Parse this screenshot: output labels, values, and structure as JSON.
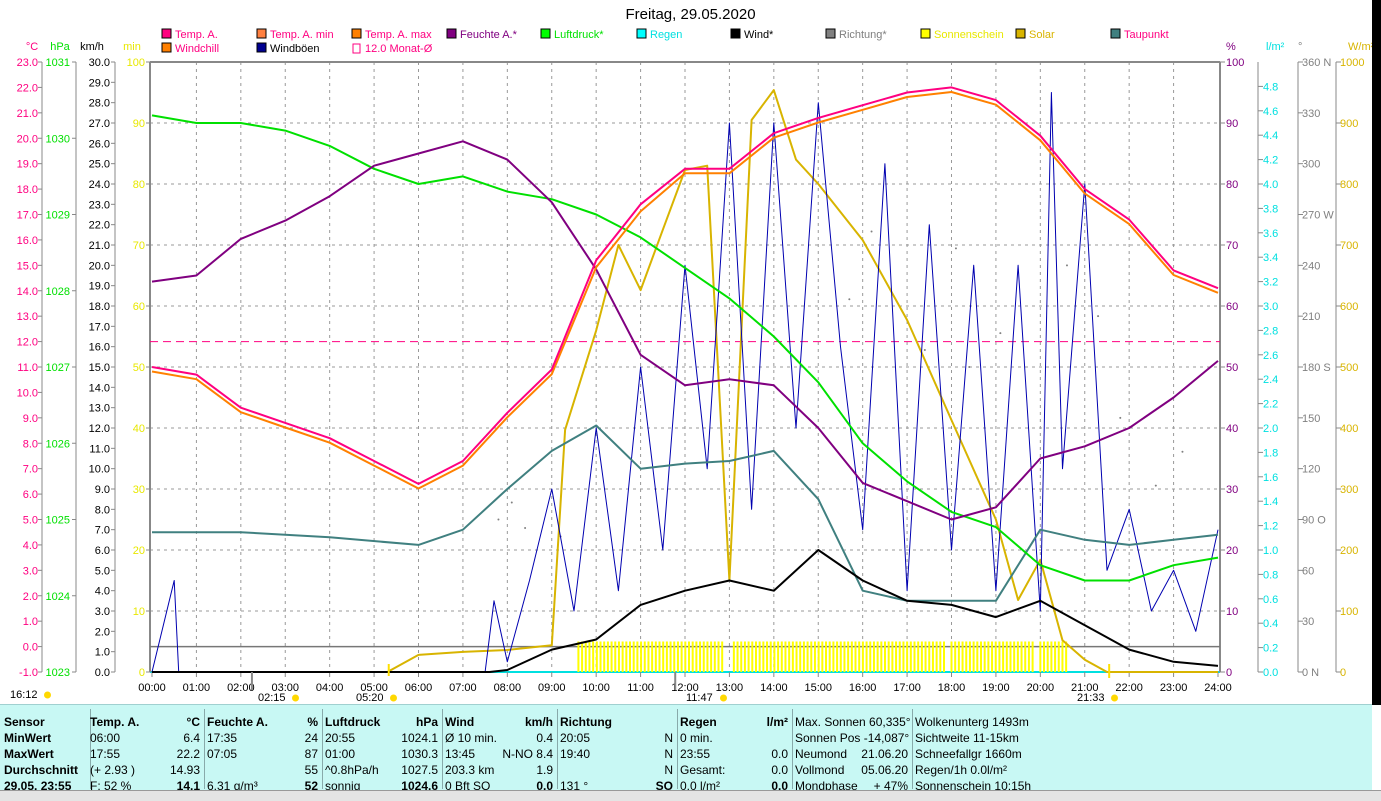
{
  "title": "Freitag, 29.05.2020",
  "legend": [
    {
      "label": "Temp. A.",
      "box": "#ff0080",
      "text": "#ff0080"
    },
    {
      "label": "Temp. A. min",
      "box": "#ff8040",
      "text": "#ff0080"
    },
    {
      "label": "Temp. A. max",
      "box": "#ff8000",
      "text": "#ff0080"
    },
    {
      "label": "Feuchte A.*",
      "box": "#800080",
      "text": "#800080"
    },
    {
      "label": "Luftdruck*",
      "box": "#00ff00",
      "text": "#00e000"
    },
    {
      "label": "Regen",
      "box": "#00ffff",
      "text": "#00e0e0"
    },
    {
      "label": "Wind*",
      "box": "#000000",
      "text": "#000000"
    },
    {
      "label": "Richtung*",
      "box": "#808080",
      "text": "#808080"
    },
    {
      "label": "Sonnenschein",
      "box": "#ffff00",
      "text": "#e8e800"
    },
    {
      "label": "Solar",
      "box": "#d8b400",
      "text": "#d8b400"
    },
    {
      "label": "Taupunkt",
      "box": "#408080",
      "text": "#ff0080"
    },
    {
      "label": "Windchill",
      "box": "#ff8000",
      "text": "#ff0080"
    },
    {
      "label": "Windböen",
      "box": "#000090",
      "text": "#000000"
    },
    {
      "label": "12.0 Monat-Ø",
      "box": "outline",
      "text": "#ff0080"
    }
  ],
  "chart_data": {
    "type": "line",
    "title": "Freitag, 29.05.2020",
    "xlabel": "",
    "x_ticks": [
      "00:00",
      "01:00",
      "02:00",
      "03:00",
      "04:00",
      "05:00",
      "06:00",
      "07:00",
      "08:00",
      "09:00",
      "10:00",
      "11:00",
      "12:00",
      "13:00",
      "14:00",
      "15:00",
      "16:00",
      "17:00",
      "18:00",
      "19:00",
      "20:00",
      "21:00",
      "22:00",
      "23:00",
      "24:00"
    ],
    "xlim": [
      0,
      24
    ],
    "grid": true,
    "axes": {
      "temp": {
        "unit": "°C",
        "color": "#ff0080",
        "range": [
          -1,
          23
        ],
        "ticks": [
          "-1.0",
          "0.0",
          "1.0",
          "2.0",
          "3.0",
          "4.0",
          "5.0",
          "6.0",
          "7.0",
          "8.0",
          "9.0",
          "10.0",
          "11.0",
          "12.0",
          "13.0",
          "14.0",
          "15.0",
          "16.0",
          "17.0",
          "18.0",
          "19.0",
          "20.0",
          "21.0",
          "22.0",
          "23.0"
        ]
      },
      "pressure": {
        "unit": "hPa",
        "color": "#00e000",
        "range": [
          1023,
          1031
        ],
        "ticks": [
          "1023",
          "1024",
          "1025",
          "1026",
          "1027",
          "1028",
          "1029",
          "1030",
          "1031"
        ]
      },
      "wind": {
        "unit": "km/h",
        "color": "#000000",
        "range": [
          0,
          30
        ],
        "ticks": [
          "0.0",
          "1.0",
          "2.0",
          "3.0",
          "4.0",
          "5.0",
          "6.0",
          "7.0",
          "8.0",
          "9.0",
          "10.0",
          "11.0",
          "12.0",
          "13.0",
          "14.0",
          "15.0",
          "16.0",
          "17.0",
          "18.0",
          "19.0",
          "20.0",
          "21.0",
          "22.0",
          "23.0",
          "24.0",
          "25.0",
          "26.0",
          "27.0",
          "28.0",
          "29.0",
          "30.0"
        ]
      },
      "sunmin": {
        "unit": "min",
        "color": "#e8e800",
        "range": [
          0,
          100
        ],
        "ticks": [
          "0",
          "10",
          "20",
          "30",
          "40",
          "50",
          "60",
          "70",
          "80",
          "90",
          "100"
        ]
      },
      "humidity": {
        "unit": "%",
        "color": "#800080",
        "range": [
          0,
          100
        ],
        "ticks": [
          "0",
          "10",
          "20",
          "30",
          "40",
          "50",
          "60",
          "70",
          "80",
          "90",
          "100"
        ]
      },
      "rain": {
        "unit": "l/m²",
        "color": "#00e0e0",
        "range": [
          0,
          5
        ],
        "ticks": [
          "0.0",
          "0.2",
          "0.4",
          "0.6",
          "0.8",
          "1.0",
          "1.2",
          "1.4",
          "1.6",
          "1.8",
          "2.0",
          "2.2",
          "2.4",
          "2.6",
          "2.8",
          "3.0",
          "3.2",
          "3.4",
          "3.6",
          "3.8",
          "4.0",
          "4.2",
          "4.4",
          "4.6",
          "4.8"
        ]
      },
      "direction": {
        "unit": "°",
        "color": "#808080",
        "range": [
          0,
          360
        ],
        "ticks": [
          "0  N",
          "30",
          "60",
          "90  O",
          "120",
          "150",
          "180  S",
          "210",
          "240",
          "270  W",
          "300",
          "330",
          "360  N"
        ]
      },
      "solar": {
        "unit": "W/m²",
        "color": "#d8b400",
        "range": [
          0,
          1000
        ],
        "ticks": [
          "0",
          "100",
          "200",
          "300",
          "400",
          "500",
          "600",
          "700",
          "800",
          "900",
          "1000"
        ]
      }
    },
    "reference_line": {
      "name": "12.0 Monat-Ø",
      "axis": "temp",
      "value": 12.0,
      "color": "#ff0080"
    },
    "series": [
      {
        "name": "Temp. A.",
        "axis": "temp",
        "color": "#ff0080",
        "x": [
          0,
          1,
          2,
          3,
          4,
          5,
          6,
          7,
          8,
          9,
          10,
          11,
          12,
          13,
          14,
          15,
          16,
          17,
          18,
          19,
          20,
          21,
          22,
          23,
          24
        ],
        "y": [
          11.0,
          10.7,
          9.4,
          8.8,
          8.2,
          7.3,
          6.4,
          7.3,
          9.2,
          10.9,
          15.2,
          17.4,
          18.8,
          18.8,
          20.2,
          20.8,
          21.3,
          21.8,
          22.0,
          21.5,
          20.1,
          18.0,
          16.8,
          14.8,
          14.1
        ]
      },
      {
        "name": "Windchill",
        "axis": "temp",
        "color": "#ff8000",
        "offset": 0.1,
        "x": [
          0,
          1,
          2,
          3,
          4,
          5,
          6,
          7,
          8,
          9,
          10,
          11,
          12,
          13,
          14,
          15,
          16,
          17,
          18,
          19,
          20,
          21,
          22,
          23,
          24
        ],
        "y": [
          10.9,
          10.6,
          9.3,
          8.7,
          8.1,
          7.2,
          6.3,
          7.2,
          9.1,
          10.8,
          15.0,
          17.2,
          18.7,
          18.7,
          20.1,
          20.7,
          21.2,
          21.7,
          21.9,
          21.4,
          20.0,
          17.9,
          16.7,
          14.7,
          14.0
        ]
      },
      {
        "name": "Feuchte A.*",
        "axis": "humidity",
        "color": "#800080",
        "x": [
          0,
          1,
          2,
          3,
          4,
          5,
          6,
          7,
          8,
          9,
          10,
          11,
          12,
          13,
          14,
          15,
          16,
          17,
          18,
          19,
          20,
          21,
          22,
          23,
          24
        ],
        "y": [
          64,
          65,
          71,
          74,
          78,
          83,
          85,
          87,
          84,
          77,
          66,
          52,
          47,
          48,
          47,
          40,
          31,
          28,
          25,
          27,
          35,
          37,
          40,
          45,
          51
        ]
      },
      {
        "name": "Luftdruck*",
        "axis": "pressure",
        "color": "#00e000",
        "x": [
          0,
          1,
          2,
          3,
          4,
          5,
          6,
          7,
          8,
          9,
          10,
          11,
          12,
          13,
          14,
          15,
          16,
          17,
          18,
          19,
          20,
          21,
          22,
          23,
          24
        ],
        "y": [
          1030.3,
          1030.2,
          1030.2,
          1030.1,
          1029.9,
          1029.6,
          1029.4,
          1029.5,
          1029.3,
          1029.2,
          1029.0,
          1028.7,
          1028.3,
          1027.9,
          1027.4,
          1026.8,
          1026.0,
          1025.5,
          1025.1,
          1024.9,
          1024.4,
          1024.2,
          1024.2,
          1024.4,
          1024.5
        ]
      },
      {
        "name": "Taupunkt",
        "axis": "temp",
        "color": "#408080",
        "x": [
          0,
          2,
          4,
          6,
          7,
          8,
          9,
          10,
          11,
          12,
          13,
          14,
          15,
          16,
          17,
          18,
          19,
          20,
          21,
          22,
          23,
          24
        ],
        "y": [
          4.5,
          4.5,
          4.3,
          4.0,
          4.6,
          6.2,
          7.7,
          8.7,
          7.0,
          7.2,
          7.3,
          7.7,
          5.8,
          2.2,
          1.8,
          1.8,
          1.8,
          4.6,
          4.2,
          4.0,
          4.2,
          4.4
        ]
      },
      {
        "name": "Wind*",
        "axis": "wind",
        "color": "#000000",
        "x": [
          0,
          7.6,
          8,
          9,
          10,
          11,
          12,
          13,
          14,
          15,
          16,
          17,
          18,
          19,
          20,
          21,
          22,
          23,
          24
        ],
        "y": [
          0,
          0,
          0.1,
          1.1,
          1.6,
          3.3,
          4.0,
          4.5,
          4.0,
          6.0,
          4.5,
          3.5,
          3.3,
          2.7,
          3.5,
          2.3,
          1.1,
          0.5,
          0.3
        ]
      },
      {
        "name": "Windböen",
        "axis": "wind",
        "color": "#0000b0",
        "x": [
          0,
          0.5,
          0.6,
          0.7,
          7.5,
          7.7,
          8,
          8.5,
          9,
          9.5,
          10,
          10.5,
          11,
          11.5,
          12,
          12.5,
          13,
          13.5,
          14,
          14.5,
          15,
          15.5,
          16,
          16.5,
          17,
          17.5,
          18,
          18.5,
          19,
          19.5,
          20,
          20.25,
          20.5,
          21,
          21.5,
          22,
          22.5,
          23,
          23.5,
          24
        ],
        "y": [
          0,
          4.5,
          0,
          0,
          0,
          3.5,
          0.5,
          4.5,
          9,
          3,
          12,
          4,
          15,
          6,
          20,
          10,
          27,
          8,
          27,
          12,
          28,
          16,
          7,
          25,
          4,
          22,
          6,
          20,
          4,
          20,
          3,
          28.5,
          10,
          24,
          5,
          8,
          3,
          5,
          2,
          7
        ]
      },
      {
        "name": "Solar",
        "axis": "solar",
        "color": "#d8b400",
        "x": [
          0,
          5.3,
          6,
          7,
          8,
          9,
          9.3,
          10,
          10.5,
          11,
          11.5,
          12,
          12.5,
          13,
          13.5,
          14,
          14.5,
          15,
          16,
          17,
          18,
          19,
          19.5,
          20,
          20.5,
          21,
          21.5,
          24
        ],
        "y": [
          0,
          0,
          28,
          33,
          36,
          44,
          397,
          560,
          700,
          626,
          725,
          823,
          830,
          150,
          905,
          954,
          840,
          800,
          708,
          577,
          413,
          250,
          118,
          184,
          52,
          20,
          0,
          0
        ]
      }
    ],
    "sunshine_intervals": [
      [
        9.6,
        12.9
      ],
      [
        13.1,
        17.9
      ],
      [
        18.0,
        19.9
      ],
      [
        20.0,
        20.6
      ]
    ],
    "sunshine_minutes": 5,
    "direction_points": {
      "x": [
        7.8,
        8.1,
        8.4,
        9.2,
        15.7,
        16.2,
        17.4,
        18.1,
        18.4,
        19.1,
        20.6,
        21.3,
        21.8,
        22.6,
        23.2
      ],
      "y": [
        90,
        100,
        85,
        80,
        220,
        260,
        190,
        250,
        180,
        200,
        240,
        210,
        150,
        110,
        130
      ]
    }
  },
  "time_markers": [
    {
      "label": "16:12",
      "icon": "moon-icon"
    },
    {
      "label": "02:15",
      "icon": "moonset-icon"
    },
    {
      "label": "05:20",
      "icon": "sunrise-icon"
    },
    {
      "label": "11:47",
      "icon": "noon-icon"
    },
    {
      "label": "21:33",
      "icon": "sunset-icon"
    }
  ],
  "table": [
    {
      "h": [
        "Sensor",
        ""
      ],
      "rows": [
        [
          "MinWert",
          ""
        ],
        [
          "MaxWert",
          ""
        ],
        [
          "Durchschnitt",
          ""
        ],
        [
          "29.05. 23:55",
          ""
        ]
      ]
    },
    {
      "h": [
        "Temp. A.",
        "°C"
      ],
      "rows": [
        [
          "06:00",
          "6.4"
        ],
        [
          "17:55",
          "22.2"
        ],
        [
          "(+ 2.93 )",
          "14.93"
        ],
        [
          "F: 52 %",
          "14.1"
        ]
      ]
    },
    {
      "h": [
        "Feuchte A.",
        "%"
      ],
      "rows": [
        [
          "17:35",
          "24"
        ],
        [
          "07:05",
          "87"
        ],
        [
          "",
          "55"
        ],
        [
          "6.31 g/m³",
          "52"
        ]
      ]
    },
    {
      "h": [
        "Luftdruck",
        "hPa"
      ],
      "rows": [
        [
          "20:55",
          "1024.1"
        ],
        [
          "01:00",
          "1030.3"
        ],
        [
          "^0.8hPa/h",
          "1027.5"
        ],
        [
          "sonnig",
          "1024.6"
        ]
      ]
    },
    {
      "h": [
        "Wind",
        "km/h"
      ],
      "rows": [
        [
          "Ø 10 min.",
          "0.4"
        ],
        [
          "13:45",
          "N-NO 8.4"
        ],
        [
          "203.3 km",
          "1.9"
        ],
        [
          "0 Bft SO",
          "0.0"
        ]
      ]
    },
    {
      "h": [
        "Richtung",
        ""
      ],
      "rows": [
        [
          "20:05",
          "N"
        ],
        [
          "19:40",
          "N"
        ],
        [
          "",
          "N"
        ],
        [
          "131 °",
          "SO"
        ]
      ]
    },
    {
      "h": [
        "Regen",
        "l/m²"
      ],
      "rows": [
        [
          "0 min.",
          ""
        ],
        [
          "23:55",
          "0.0"
        ],
        [
          "Gesamt:",
          "0.0"
        ],
        [
          "0.0 l/m²",
          "0.0"
        ]
      ]
    },
    {
      "h": [
        "Max. Sonnen 60,335°",
        ""
      ],
      "rows": [
        [
          "Sonnen Pos -14,087°",
          ""
        ],
        [
          "Neumond",
          "21.06.20"
        ],
        [
          "Vollmond",
          "05.06.20"
        ],
        [
          "Mondphase",
          "+ 47%"
        ]
      ]
    },
    {
      "h": [
        "Wolkenunterg 1493m",
        ""
      ],
      "rows": [
        [
          "Sichtweite   11-15km",
          ""
        ],
        [
          "Schneefallgr   1660m",
          ""
        ],
        [
          "Regen/1h     0.0l/m²",
          ""
        ],
        [
          "Sonnenschein 10:15h",
          ""
        ]
      ]
    }
  ]
}
